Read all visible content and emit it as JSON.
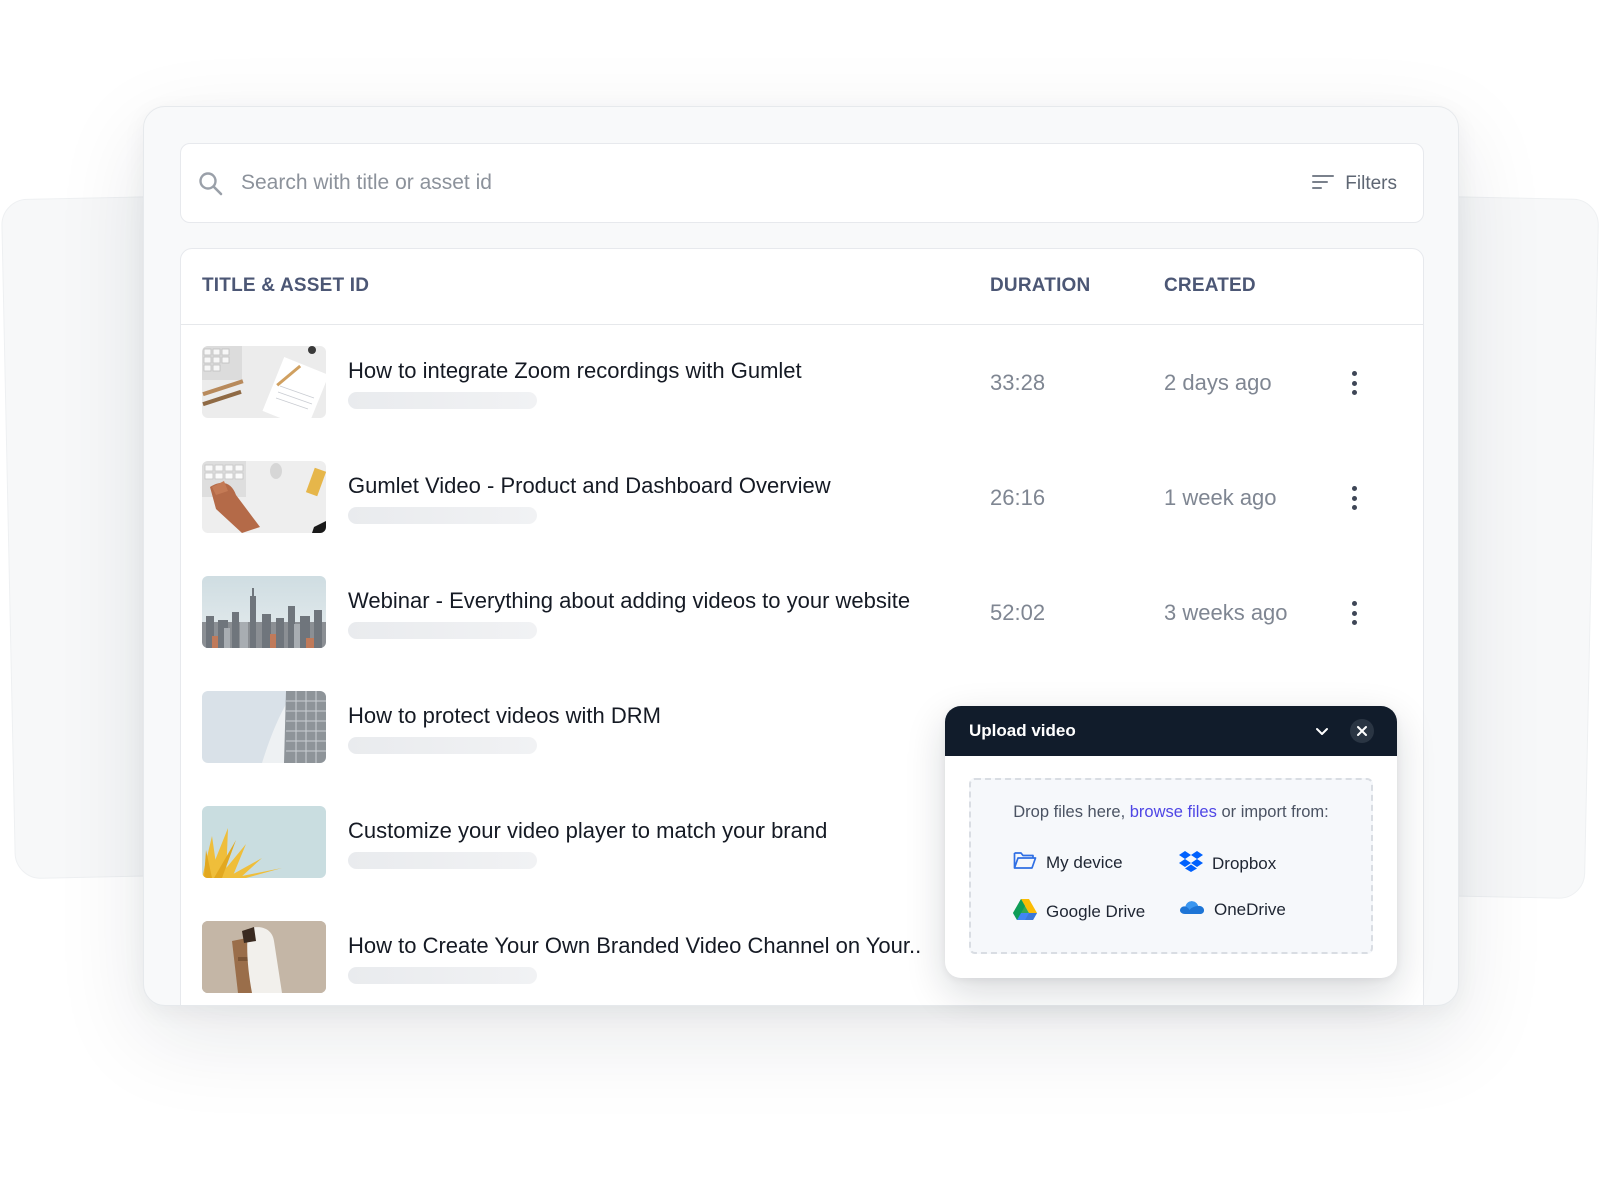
{
  "search": {
    "placeholder": "Search with title or asset id",
    "filters_label": "Filters"
  },
  "table": {
    "headers": {
      "title": "TITLE & ASSET ID",
      "duration": "DURATION",
      "created": "CREATED"
    },
    "rows": [
      {
        "title": "How to integrate Zoom recordings with Gumlet",
        "duration": "33:28",
        "created": "2 days ago"
      },
      {
        "title": "Gumlet Video - Product and Dashboard Overview",
        "duration": "26:16",
        "created": "1 week ago"
      },
      {
        "title": "Webinar - Everything about adding videos to your website",
        "duration": "52:02",
        "created": "3 weeks ago"
      },
      {
        "title": "How to protect videos with DRM",
        "duration": "",
        "created": ""
      },
      {
        "title": "Customize your video player to match your brand",
        "duration": "",
        "created": ""
      },
      {
        "title": "How to Create Your Own Branded Video Channel on Your..",
        "duration": "",
        "created": ""
      }
    ]
  },
  "upload": {
    "title": "Upload video",
    "drop_prefix": "Drop files here, ",
    "browse_link": "browse files",
    "drop_suffix": " or import from:",
    "sources": {
      "my_device": "My device",
      "dropbox": "Dropbox",
      "google_drive": "Google Drive",
      "onedrive": "OneDrive"
    }
  },
  "colors": {
    "header_text": "#4c5775",
    "upload_header_bg": "#111c2b",
    "link": "#4f46e5",
    "dropbox_blue": "#0061fe",
    "onedrive_blue": "#1e75d6",
    "device_blue": "#2f6fe4"
  }
}
